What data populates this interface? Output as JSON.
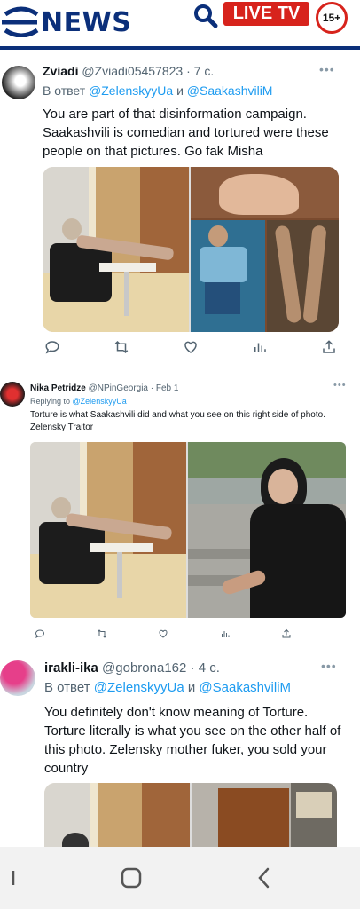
{
  "header": {
    "brand": "NEWS",
    "live_label": "LIVE TV",
    "age_rating": "15+"
  },
  "tweets": [
    {
      "name": "Zviadi",
      "handle": "@Zviadi05457823",
      "time": "· 7 с.",
      "reply_prefix": "В ответ",
      "reply_to_1": "@ZelenskyyUa",
      "reply_conj": "и",
      "reply_to_2": "@SaakashviliM",
      "text": "You are part of that disinformation campaign. Saakashvili is comedian and tortured were these people on that pictures. Go fak Misha"
    },
    {
      "name": "Nika Petridze",
      "handle": "@NPinGeorgia",
      "time": "· Feb 1",
      "reply_prefix": "Replying to",
      "reply_to_1": "@ZelenskyyUa",
      "text": "Torture is what Saakashvili did and what you see on this right side of photo. Zelensky Traitor"
    },
    {
      "name": "irakli-ika",
      "handle": "@gobrona162",
      "time": "· 4 с.",
      "reply_prefix": "В ответ",
      "reply_to_1": "@ZelenskyyUa",
      "reply_conj": "и",
      "reply_to_2": "@SaakashviliM",
      "text": "You definitely don't know meaning of Torture. Torture literally  is what you see on the other half of this photo. Zelensky mother fuker, you sold your country"
    }
  ],
  "icons": {
    "reply": "reply-icon",
    "retweet": "retweet-icon",
    "like": "like-icon",
    "views": "views-icon",
    "share": "share-icon"
  },
  "colors": {
    "brand_blue": "#0b2f7a",
    "live_red": "#d7231c",
    "link_blue": "#1d9bf0"
  }
}
